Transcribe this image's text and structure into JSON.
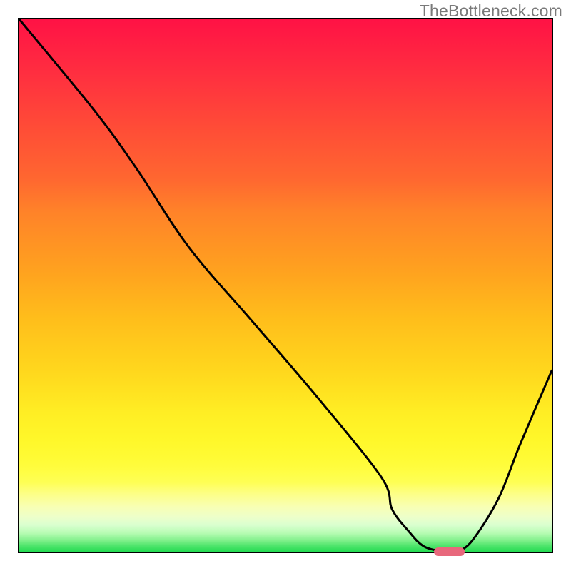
{
  "watermark": "TheBottleneck.com",
  "chart_data": {
    "type": "line",
    "title": "",
    "xlabel": "",
    "ylabel": "",
    "xlim": [
      0,
      100
    ],
    "ylim": [
      0,
      100
    ],
    "background": "red-to-green vertical gradient (bottleneck curve)",
    "series": [
      {
        "name": "bottleneck-curve",
        "x": [
          0,
          14,
          22,
          32,
          44,
          56,
          68,
          70,
          73,
          76,
          80,
          82,
          85,
          90,
          94,
          100
        ],
        "values": [
          100,
          83,
          72,
          57,
          43,
          29,
          14,
          8,
          4,
          1,
          0,
          0,
          2,
          10,
          20,
          34
        ]
      }
    ],
    "annotations": [
      {
        "name": "optimal-marker",
        "x_start": 77.5,
        "x_end": 83.2,
        "y": 0
      }
    ],
    "colors": {
      "curve": "#000000",
      "marker": "#e8687c",
      "gradient_top": "#ff1245",
      "gradient_bottom": "#24db52"
    }
  }
}
